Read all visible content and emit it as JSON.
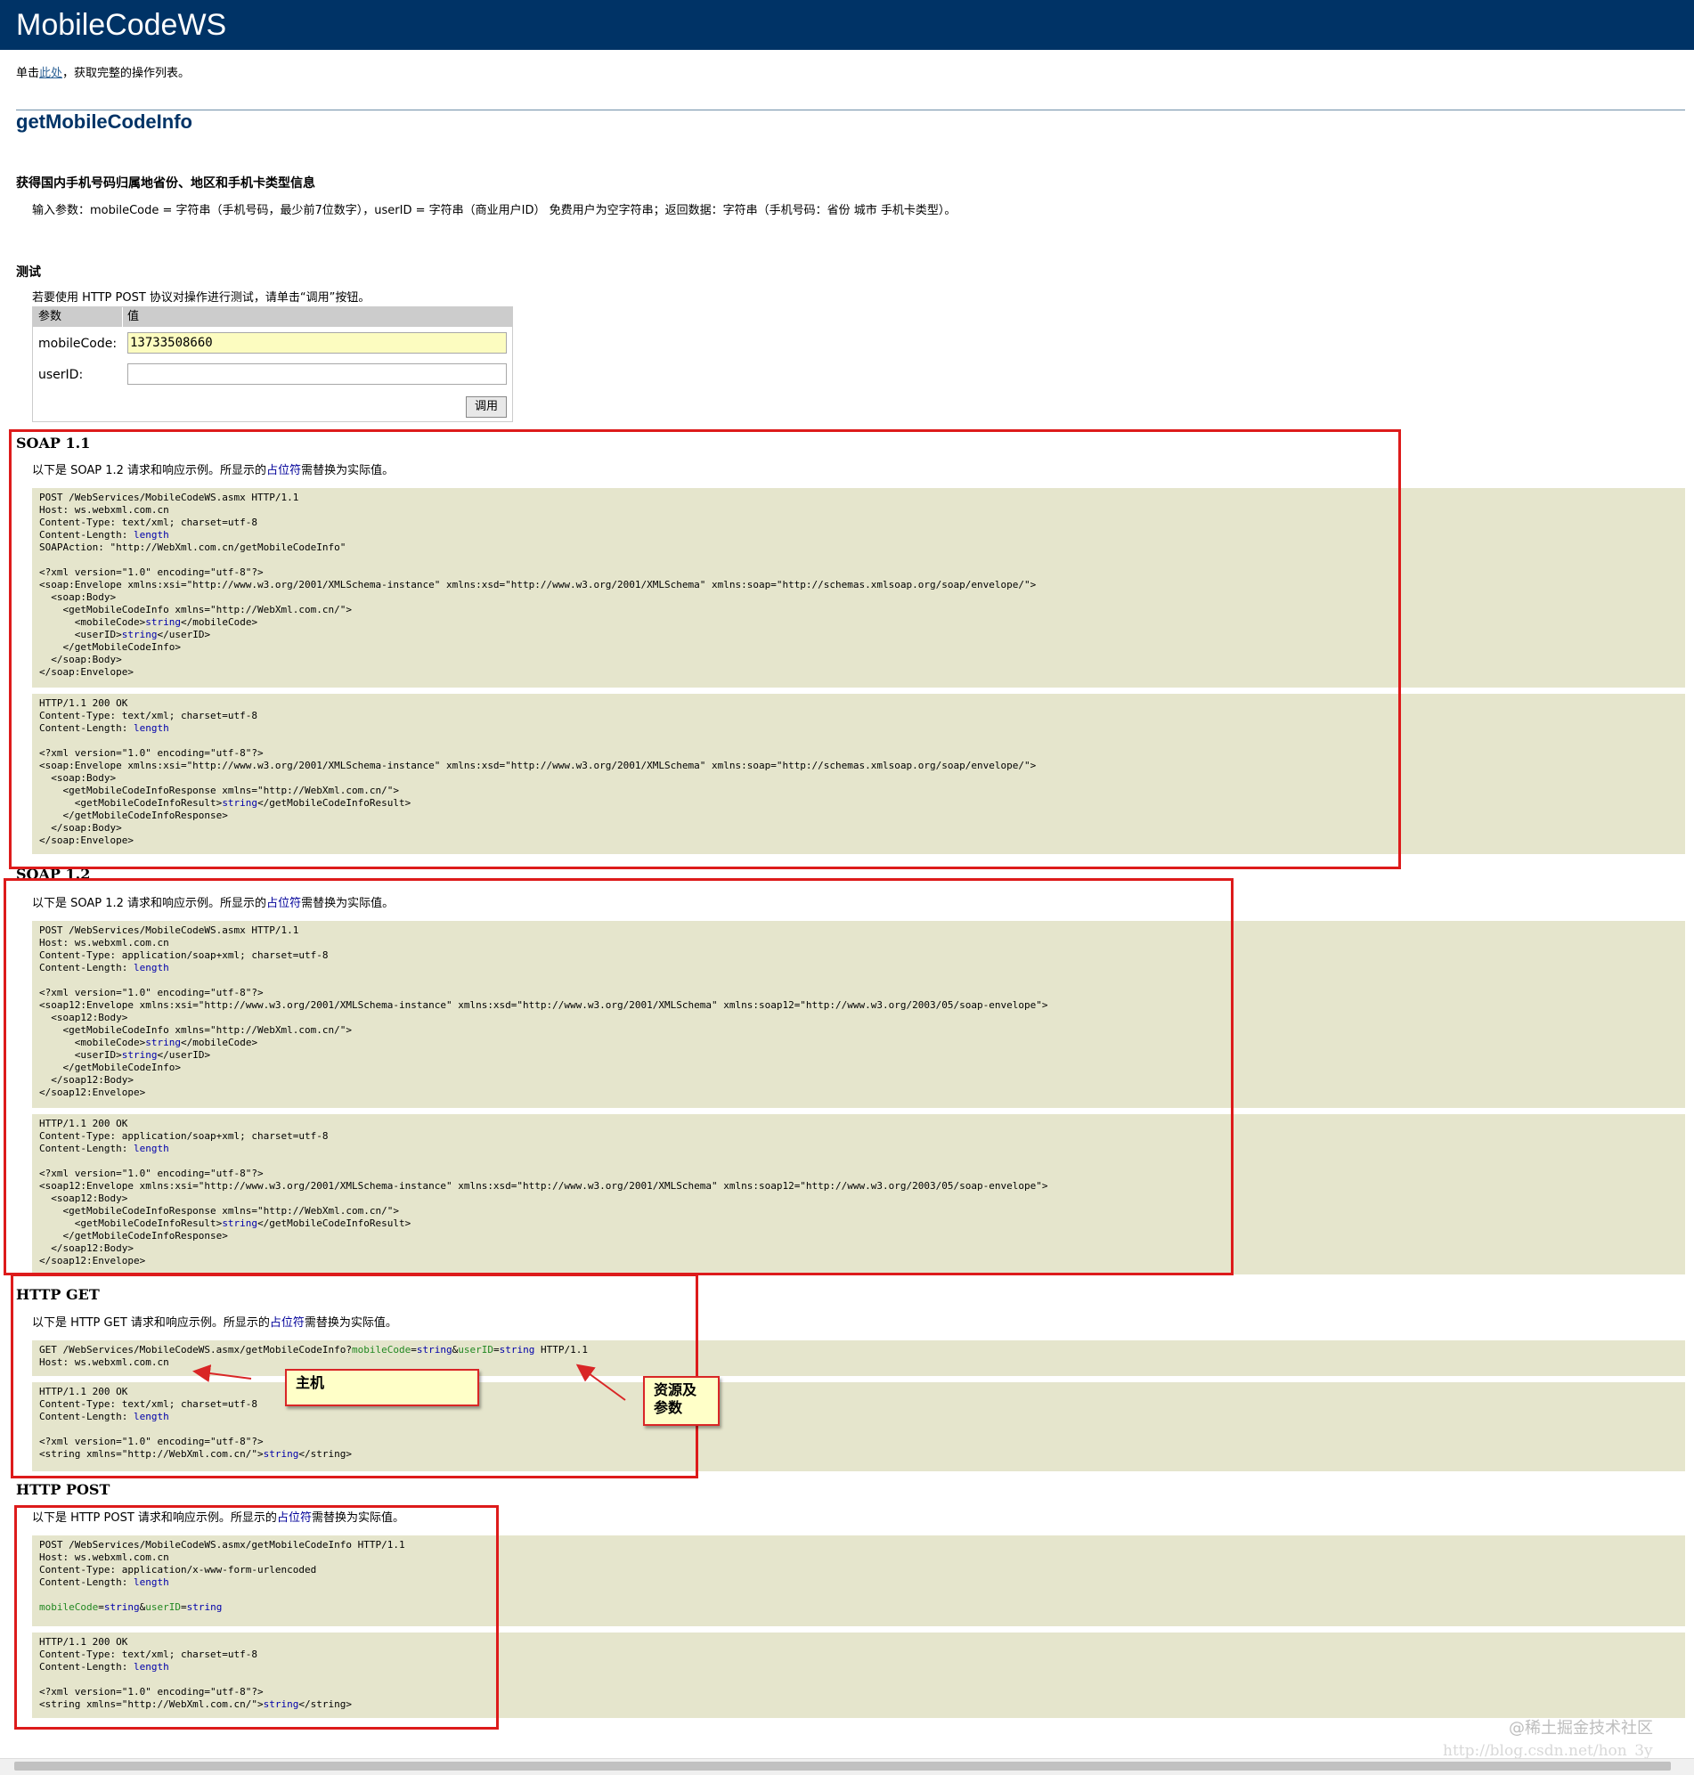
{
  "header": {
    "title": "MobileCodeWS"
  },
  "intro": {
    "prefix": "单击",
    "link": "此处",
    "suffix": "，获取完整的操作列表。"
  },
  "operation": {
    "name": "getMobileCodeInfo",
    "summary": "获得国内手机号码归属地省份、地区和手机卡类型信息",
    "description": "输入参数：mobileCode = 字符串（手机号码，最少前7位数字），userID = 字符串（商业用户ID） 免费用户为空字符串；返回数据：字符串（手机号码：省份 城市 手机卡类型）。"
  },
  "test": {
    "heading": "测试",
    "instruction": "若要使用 HTTP POST 协议对操作进行测试，请单击“调用”按钮。",
    "col_param": "参数",
    "col_value": "值",
    "mobile_label": "mobileCode:",
    "mobile_value": "13733508660",
    "userid_label": "userID:",
    "userid_value": "",
    "invoke": "调用"
  },
  "soap11": {
    "heading": "SOAP 1.1",
    "desc_prefix": "以下是 SOAP 1.2 请求和响应示例。所显示的",
    "desc_link": "占位符",
    "desc_suffix": "需替换为实际值。",
    "request": [
      "POST /WebServices/MobileCodeWS.asmx HTTP/1.1",
      "Host: ws.webxml.com.cn",
      "Content-Type: text/xml; charset=utf-8",
      "Content-Length: length",
      "SOAPAction: \"http://WebXml.com.cn/getMobileCodeInfo\"",
      "",
      "<?xml version=\"1.0\" encoding=\"utf-8\"?>",
      "<soap:Envelope xmlns:xsi=\"http://www.w3.org/2001/XMLSchema-instance\" xmlns:xsd=\"http://www.w3.org/2001/XMLSchema\" xmlns:soap=\"http://schemas.xmlsoap.org/soap/envelope/\">",
      "  <soap:Body>",
      "    <getMobileCodeInfo xmlns=\"http://WebXml.com.cn/\">",
      "      <mobileCode>string</mobileCode>",
      "      <userID>string</userID>",
      "    </getMobileCodeInfo>",
      "  </soap:Body>",
      "</soap:Envelope>"
    ],
    "response": [
      "HTTP/1.1 200 OK",
      "Content-Type: text/xml; charset=utf-8",
      "Content-Length: length",
      "",
      "<?xml version=\"1.0\" encoding=\"utf-8\"?>",
      "<soap:Envelope xmlns:xsi=\"http://www.w3.org/2001/XMLSchema-instance\" xmlns:xsd=\"http://www.w3.org/2001/XMLSchema\" xmlns:soap=\"http://schemas.xmlsoap.org/soap/envelope/\">",
      "  <soap:Body>",
      "    <getMobileCodeInfoResponse xmlns=\"http://WebXml.com.cn/\">",
      "      <getMobileCodeInfoResult>string</getMobileCodeInfoResult>",
      "    </getMobileCodeInfoResponse>",
      "  </soap:Body>",
      "</soap:Envelope>"
    ]
  },
  "soap12": {
    "heading": "SOAP 1.2",
    "desc_prefix": "以下是 SOAP 1.2 请求和响应示例。所显示的",
    "desc_link": "占位符",
    "desc_suffix": "需替换为实际值。",
    "request": [
      "POST /WebServices/MobileCodeWS.asmx HTTP/1.1",
      "Host: ws.webxml.com.cn",
      "Content-Type: application/soap+xml; charset=utf-8",
      "Content-Length: length",
      "",
      "<?xml version=\"1.0\" encoding=\"utf-8\"?>",
      "<soap12:Envelope xmlns:xsi=\"http://www.w3.org/2001/XMLSchema-instance\" xmlns:xsd=\"http://www.w3.org/2001/XMLSchema\" xmlns:soap12=\"http://www.w3.org/2003/05/soap-envelope\">",
      "  <soap12:Body>",
      "    <getMobileCodeInfo xmlns=\"http://WebXml.com.cn/\">",
      "      <mobileCode>string</mobileCode>",
      "      <userID>string</userID>",
      "    </getMobileCodeInfo>",
      "  </soap12:Body>",
      "</soap12:Envelope>"
    ],
    "response": [
      "HTTP/1.1 200 OK",
      "Content-Type: application/soap+xml; charset=utf-8",
      "Content-Length: length",
      "",
      "<?xml version=\"1.0\" encoding=\"utf-8\"?>",
      "<soap12:Envelope xmlns:xsi=\"http://www.w3.org/2001/XMLSchema-instance\" xmlns:xsd=\"http://www.w3.org/2001/XMLSchema\" xmlns:soap12=\"http://www.w3.org/2003/05/soap-envelope\">",
      "  <soap12:Body>",
      "    <getMobileCodeInfoResponse xmlns=\"http://WebXml.com.cn/\">",
      "      <getMobileCodeInfoResult>string</getMobileCodeInfoResult>",
      "    </getMobileCodeInfoResponse>",
      "  </soap12:Body>",
      "</soap12:Envelope>"
    ]
  },
  "httpget": {
    "heading": "HTTP GET",
    "desc_prefix": "以下是 HTTP GET 请求和响应示例。所显示的",
    "desc_link": "占位符",
    "desc_suffix": "需替换为实际值。",
    "request": [
      "GET /WebServices/MobileCodeWS.asmx/getMobileCodeInfo?mobileCode=string&userID=string HTTP/1.1",
      "Host: ws.webxml.com.cn"
    ],
    "response": [
      "HTTP/1.1 200 OK",
      "Content-Type: text/xml; charset=utf-8",
      "Content-Length: length",
      "",
      "<?xml version=\"1.0\" encoding=\"utf-8\"?>",
      "<string xmlns=\"http://WebXml.com.cn/\">string</string>"
    ]
  },
  "httppost": {
    "heading": "HTTP POST",
    "desc_prefix": "以下是 HTTP POST 请求和响应示例。所显示的",
    "desc_link": "占位符",
    "desc_suffix": "需替换为实际值。",
    "request": [
      "POST /WebServices/MobileCodeWS.asmx/getMobileCodeInfo HTTP/1.1",
      "Host: ws.webxml.com.cn",
      "Content-Type: application/x-www-form-urlencoded",
      "Content-Length: length",
      "",
      "mobileCode=string&userID=string"
    ],
    "response": [
      "HTTP/1.1 200 OK",
      "Content-Type: text/xml; charset=utf-8",
      "Content-Length: length",
      "",
      "<?xml version=\"1.0\" encoding=\"utf-8\"?>",
      "<string xmlns=\"http://WebXml.com.cn/\">string</string>"
    ]
  },
  "annotations": {
    "host_callout": "主机",
    "params_callout_line1": "资源及",
    "params_callout_line2": "参数",
    "colors": {
      "highlight": "#dd1b1b",
      "callout_bg": "#ffffc8",
      "code_bg": "#e5e5cc",
      "header_bg": "#003366"
    }
  },
  "watermark": {
    "line1": "@稀土掘金技术社区",
    "line2": "http://blog.csdn.net/hon_3y"
  }
}
